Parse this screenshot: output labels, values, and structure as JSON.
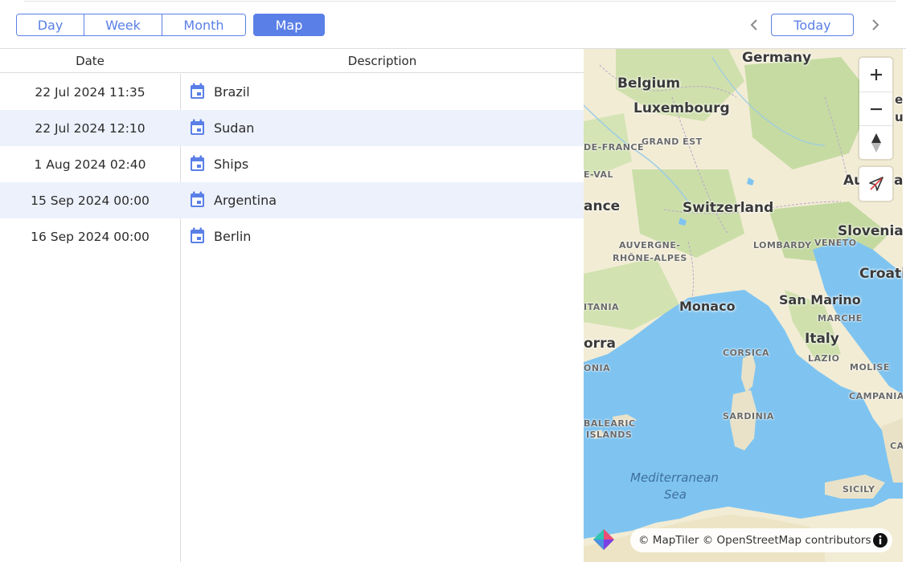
{
  "toolbar": {
    "views": [
      "Day",
      "Week",
      "Month"
    ],
    "active_view": "Map",
    "today_label": "Today"
  },
  "list": {
    "columns": {
      "date": "Date",
      "description": "Description"
    },
    "rows": [
      {
        "date": "22 Jul 2024 11:35",
        "description": "Brazil"
      },
      {
        "date": "22 Jul 2024 12:10",
        "description": "Sudan"
      },
      {
        "date": "1 Aug 2024 02:40",
        "description": "Ships"
      },
      {
        "date": "15 Sep 2024 00:00",
        "description": "Argentina"
      },
      {
        "date": "16 Sep 2024 00:00",
        "description": "Berlin"
      }
    ]
  },
  "map": {
    "places": {
      "germany": "Germany",
      "belgium": "Belgium",
      "luxembourg": "Luxembourg",
      "grand_est": "GRAND EST",
      "ile_de_france": "DE-FRANCE",
      "e_val": "E-VAL",
      "france": "ance",
      "switzerland": "Switzerland",
      "austria": "Au",
      "austria_tail": "a",
      "slovenia": "Slovenia",
      "croatia": "Croati",
      "veneto": "VENETO",
      "lombardy": "LOMBARDY",
      "auvergne": "AUVERGNE-",
      "rhone_alpes": "RHÔNE-ALPES",
      "occitania": "ITANIA",
      "monaco": "Monaco",
      "san_marino": "San Marino",
      "marche": "MARCHE",
      "corsica": "CORSICA",
      "italy": "Italy",
      "lazio": "LAZIO",
      "andorra": "orra",
      "catalonia": "ONIA",
      "molise": "MOLISE",
      "campania": "CAMPANIA",
      "sardinia": "SARDINIA",
      "balearic1": "BALEARIC",
      "balearic2": "ISLANDS",
      "sea1": "Mediterranean",
      "sea2": "Sea",
      "sicily": "SICILY",
      "calabria": "CA",
      "lux_edge": "ec",
      "lux_edge2": "ub"
    },
    "attribution": "© MapTiler © OpenStreetMap contributors",
    "colors": {
      "land": "#f2ecd5",
      "forest": "#c9dca6",
      "water": "#7fc4f0",
      "accent": "#5a7fe6"
    }
  }
}
